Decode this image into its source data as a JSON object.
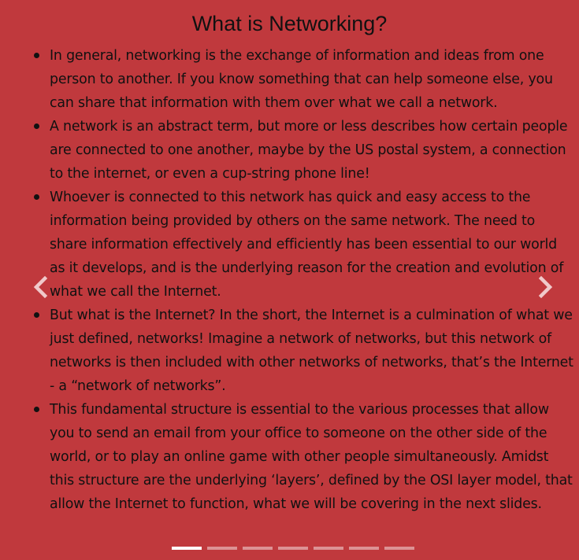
{
  "slide": {
    "title": "What is Networking?",
    "bullets": [
      "In general, networking is the exchange of information and ideas from one person to another. If you know something that can help someone else, you can share that information with them over what we call a network.",
      "A network is an abstract term, but more or less describes how certain people are connected to one another, maybe by the US postal system, a connection to the internet, or even a cup-string phone line!",
      "Whoever is connected to this network has quick and easy access to the information being provided by others on the same network. The need to share information effectively and efficiently has been essential to our world as it develops, and is the underlying reason for the creation and evolution of what we call the Internet.",
      "But what is the Internet? In the short, the Internet is a culmination of what we just defined, networks! Imagine a network of networks, but this network of networks is then included with other networks of networks, that’s the Internet - a “network of networks”.",
      "This fundamental structure is essential to the various processes that allow you to send an email from your office to someone on the other side of the world, or to play an online game with other people simultaneously. Amidst this structure are the underlying ‘layers’, defined by the OSI layer model, that allow the Internet to function, what we will be covering in the next slides."
    ]
  },
  "controls": {
    "prev_icon": "chevron-left-icon",
    "next_icon": "chevron-right-icon",
    "indicator_count": 7,
    "active_indicator": 0
  },
  "colors": {
    "background": "#c0393d",
    "text": "#111111",
    "arrow": "#f0c9ca",
    "indicator_active": "#ffffff",
    "indicator_inactive": "#e39a9c"
  }
}
